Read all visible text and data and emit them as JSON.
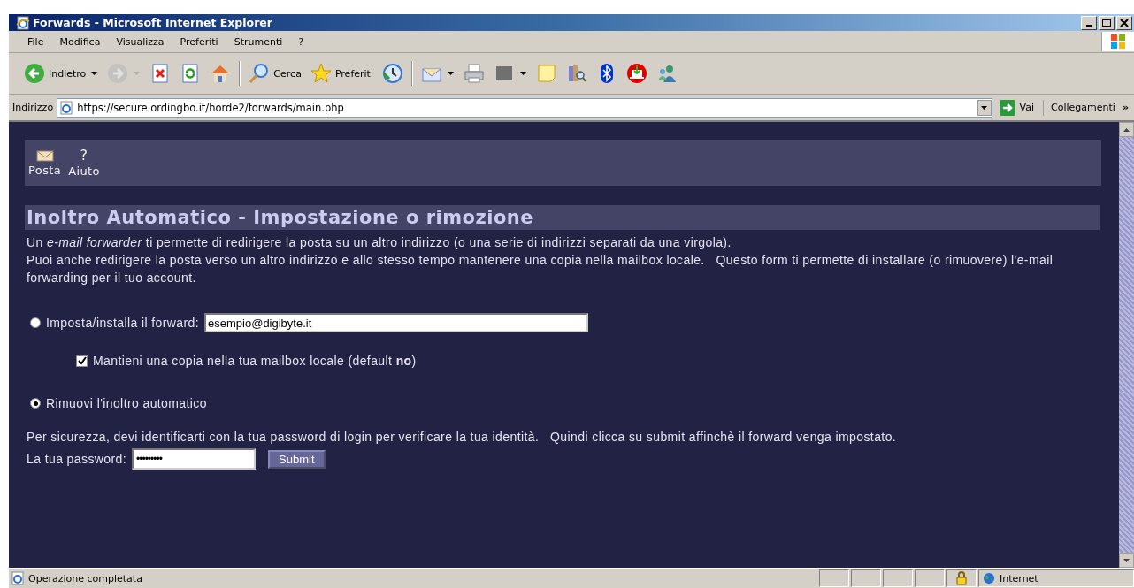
{
  "window": {
    "title": "Forwards - Microsoft Internet Explorer"
  },
  "menu": [
    {
      "label": "File"
    },
    {
      "label": "Modifica"
    },
    {
      "label": "Visualizza"
    },
    {
      "label": "Preferiti"
    },
    {
      "label": "Strumenti"
    },
    {
      "label": "?"
    }
  ],
  "toolbar": [
    {
      "kind": "button",
      "label": "Indietro",
      "dropdown": true,
      "disabled": false
    },
    {
      "kind": "button",
      "dropdown": true,
      "disabled": true
    },
    {
      "kind": "button",
      "dropdown": false,
      "disabled": false
    },
    {
      "kind": "button",
      "dropdown": false,
      "disabled": false
    },
    {
      "kind": "button",
      "dropdown": false,
      "disabled": false
    },
    {
      "kind": "separator"
    },
    {
      "kind": "button",
      "label": "Cerca",
      "dropdown": false,
      "disabled": false
    },
    {
      "kind": "button",
      "label": "Preferiti",
      "dropdown": false,
      "disabled": false
    },
    {
      "kind": "button",
      "dropdown": false,
      "disabled": false
    },
    {
      "kind": "separator"
    },
    {
      "kind": "button",
      "dropdown": true,
      "disabled": false
    },
    {
      "kind": "button",
      "dropdown": false,
      "disabled": false
    },
    {
      "kind": "button",
      "dropdown": true,
      "disabled": false
    },
    {
      "kind": "button",
      "dropdown": false,
      "disabled": false
    },
    {
      "kind": "button",
      "dropdown": false,
      "disabled": false
    },
    {
      "kind": "button",
      "dropdown": false,
      "disabled": false
    },
    {
      "kind": "button",
      "dropdown": false,
      "disabled": false
    },
    {
      "kind": "button",
      "dropdown": false,
      "disabled": false
    }
  ],
  "address_bar": {
    "label": "Indirizzo",
    "url": "https://secure.ordingbo.it/horde2/forwards/main.php",
    "go": "Vai",
    "links": "Collegamenti",
    "more": "»"
  },
  "page": {
    "nav": [
      {
        "kind": "mail",
        "label": "Posta"
      },
      {
        "kind": "help",
        "icon": "?",
        "label": "Aiuto"
      }
    ],
    "heading": "Inoltro Automatico - Impostazione o rimozione",
    "intro": [
      "Un *e-mail forwarder* ti permette di redirigere la posta su un altro indirizzo (o una serie di indirizzi separati da una virgola).",
      "Puoi anche redirigere la posta verso un altro indirizzo e allo stesso tempo mantenere una copia nella mailbox locale.   Questo form ti permette di installare (o rimuovere) l'e-mail forwarding per il tuo account."
    ],
    "set_forward": {
      "label": "Imposta/installa il forward:",
      "selected": false,
      "value": "esempio@digibyte.it"
    },
    "keep_copy": {
      "label": "Mantieni una copia nella tua mailbox locale (default **no**)",
      "checked": true
    },
    "remove_forward": {
      "label": "Rimuovi l'inoltro automatico",
      "selected": true
    },
    "security_note": "Per sicurezza, devi identificarti con la tua password di login per verificare la tua identità.   Quindi clicca su submit affinchè il forward venga impostato.",
    "password": {
      "label": "La tua password:",
      "value": "•••••••••"
    },
    "submit": "Submit"
  },
  "status_bar": {
    "text": "Operazione completata",
    "zone": "Internet"
  }
}
